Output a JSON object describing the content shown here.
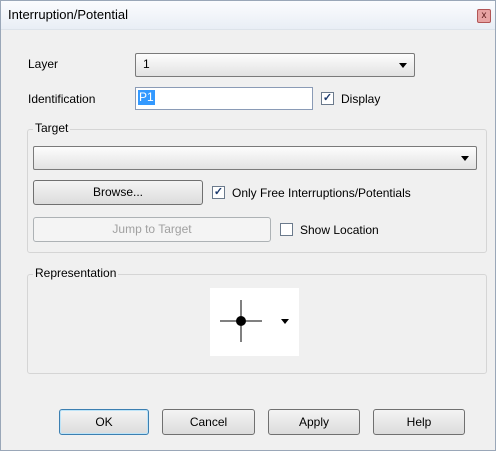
{
  "window": {
    "title": "Interruption/Potential",
    "close_glyph": "x"
  },
  "layer": {
    "label": "Layer",
    "value": "1"
  },
  "identification": {
    "label": "Identification",
    "value": "P1"
  },
  "display": {
    "label": "Display",
    "checked": true
  },
  "target": {
    "group_label": "Target",
    "combo_value": "",
    "browse_label": "Browse...",
    "only_free": {
      "label": "Only Free Interruptions/Potentials",
      "checked": true
    },
    "jump_label": "Jump to Target",
    "show_location": {
      "label": "Show Location",
      "checked": false
    }
  },
  "representation": {
    "group_label": "Representation",
    "symbol": "crosshair-dot-icon"
  },
  "buttons": {
    "ok": "OK",
    "cancel": "Cancel",
    "apply": "Apply",
    "help": "Help"
  }
}
